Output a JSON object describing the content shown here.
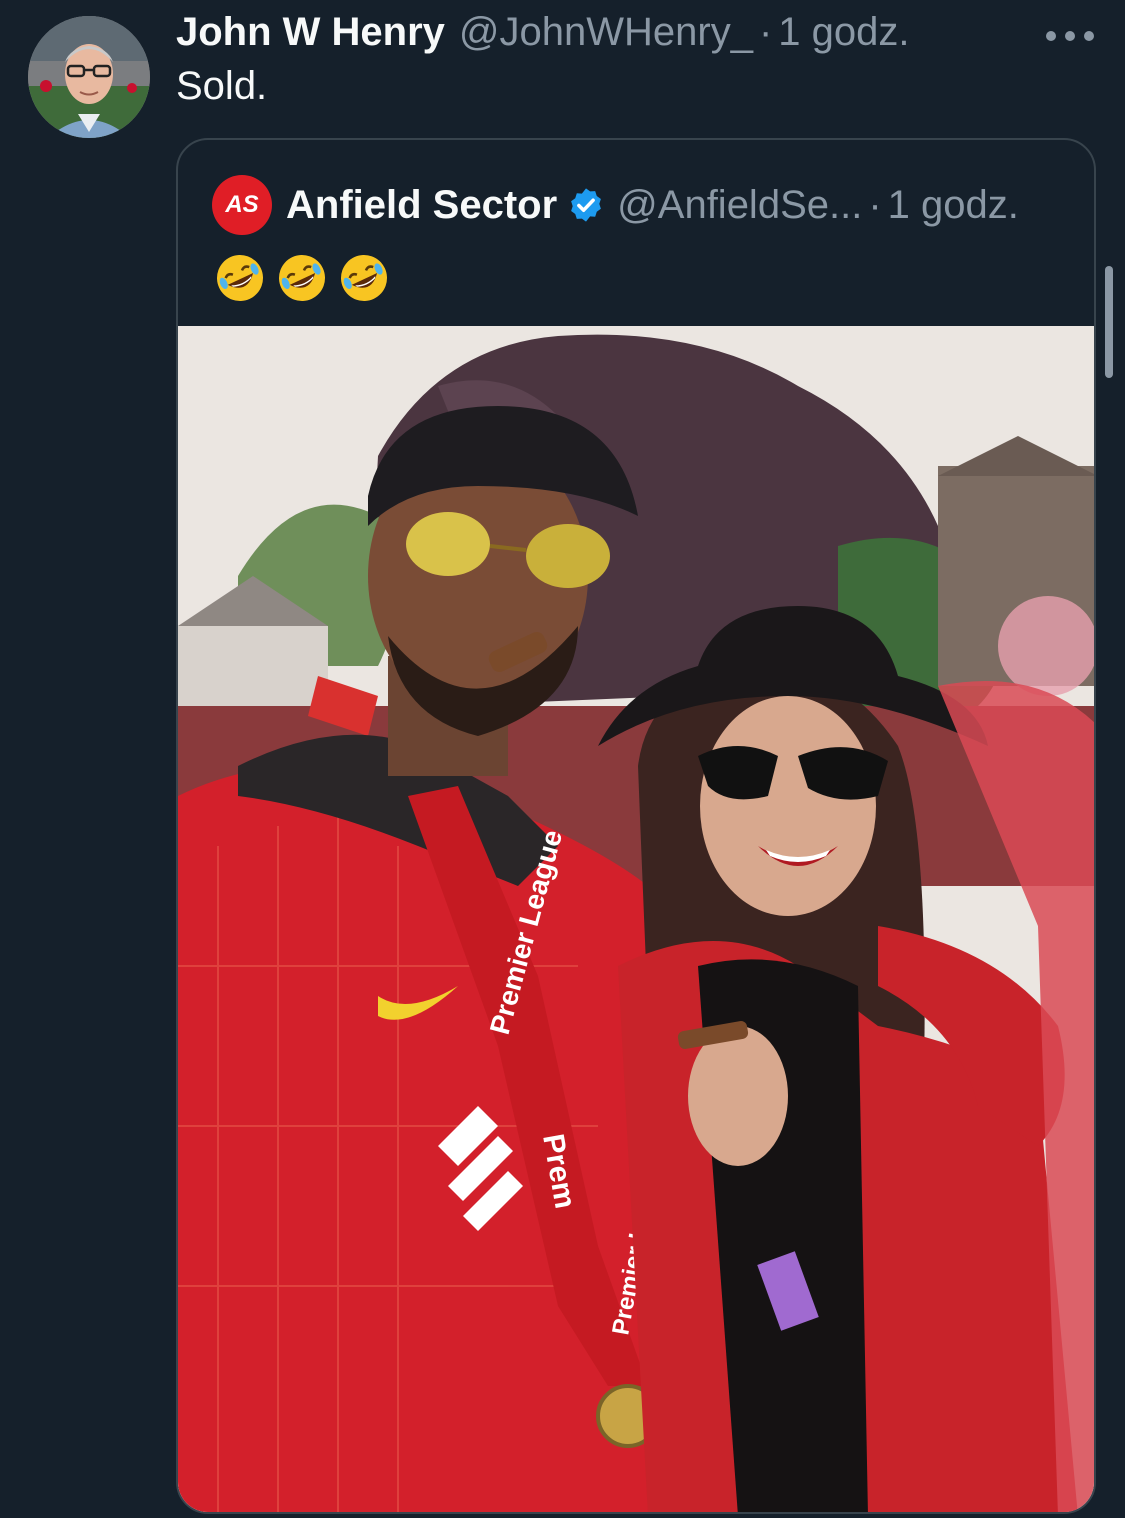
{
  "tweet": {
    "display_name": "John W Henry",
    "handle": "@JohnWHenry_",
    "separator": "·",
    "time": "1 godz.",
    "text": "Sold."
  },
  "quote": {
    "display_name": "Anfield Sector",
    "handle": "@AnfieldSe...",
    "separator": "·",
    "time": "1 godz.",
    "emoji_text": "🤣🤣🤣",
    "logo_text": "AS",
    "photo_text": {
      "lanyard_left": "Premier League",
      "lanyard_right": "Premier League",
      "shirt_text": "Prem"
    }
  },
  "icons": {
    "more": "more-horizontal-icon",
    "verified": "verified-badge-icon",
    "emoji": "rolling-on-floor-laughing-emoji"
  },
  "colors": {
    "background": "#15202b",
    "text_primary": "#f7f9f9",
    "text_secondary": "#8b98a5",
    "border": "#38444d",
    "verified": "#1d9bf0",
    "liverpool_red": "#d3202b"
  }
}
